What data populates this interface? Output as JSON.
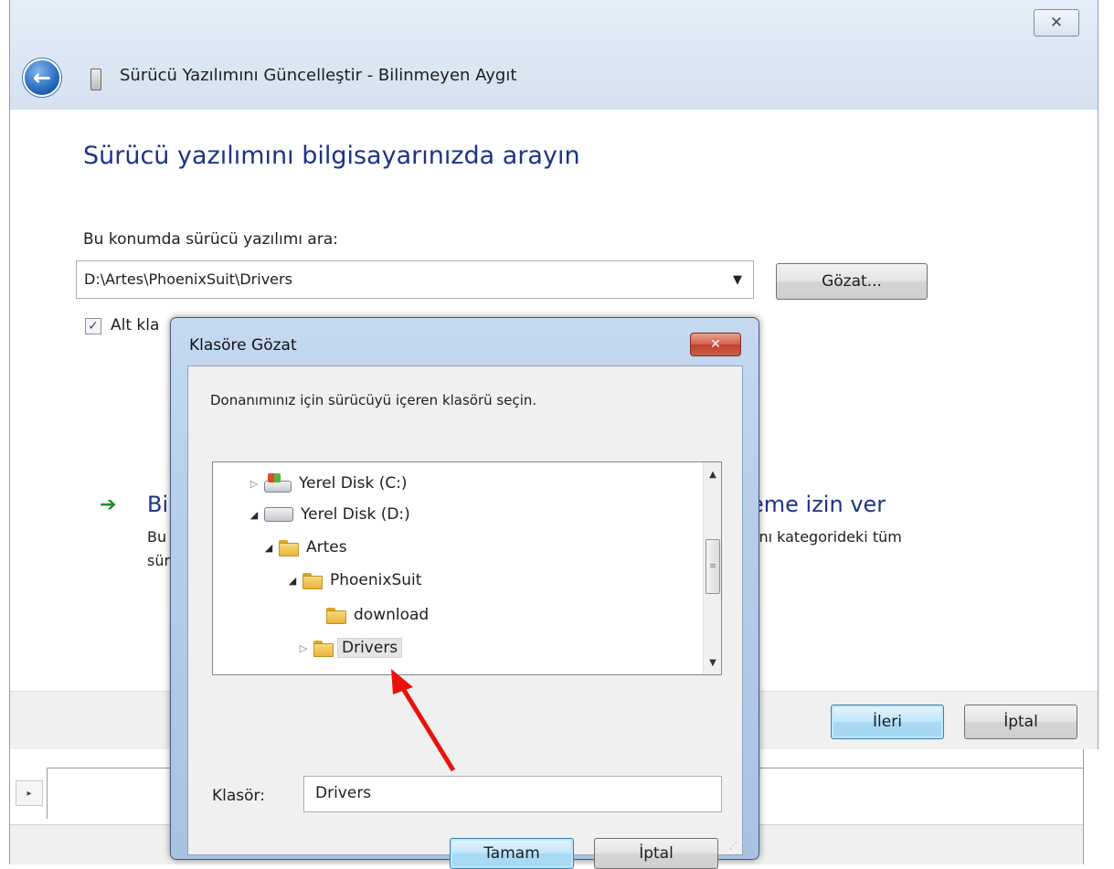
{
  "wizard": {
    "title": "Sürücü Yazılımını Güncelleştir - Bilinmeyen Aygıt",
    "close_glyph": "✕",
    "back_glyph": "←",
    "heading": "Sürücü yazılımını bilgisayarınızda arayın",
    "search_label": "Bu konumda sürücü yazılımı ara:",
    "path_value": "D:\\Artes\\PhoenixSuit\\Drivers",
    "path_dropdown_glyph": "▼",
    "browse_button": "Gözat...",
    "include_subfolders_label_visible": "Alt kla",
    "include_subfolders_checked": true,
    "option_arrow_glyph": "➔",
    "option_title_left": "Bi",
    "option_title_right": "eme izin ver",
    "option_desc_line1_left": "Bu",
    "option_desc_line1_right": "ynı kategorideki tüm",
    "option_desc_line2_left": "sür",
    "next_button": "İleri",
    "cancel_button": "İptal"
  },
  "device_manager": {
    "expand_glyph": "▸"
  },
  "browse_dialog": {
    "title": "Klasöre Gözat",
    "close_glyph": "✕",
    "instruction": "Donanımınız için sürücüyü içeren klasörü seçin.",
    "tree": [
      {
        "label": "Yerel Disk (C:)",
        "expander": "▷",
        "icon": "windows-drive-icon",
        "depth": 0
      },
      {
        "label": "Yerel Disk (D:)",
        "expander": "◢",
        "icon": "drive-icon",
        "depth": 0
      },
      {
        "label": "Artes",
        "expander": "◢",
        "icon": "folder-icon",
        "depth": 1
      },
      {
        "label": "PhoenixSuit",
        "expander": "◢",
        "icon": "folder-icon",
        "depth": 2
      },
      {
        "label": "download",
        "expander": "",
        "icon": "folder-icon",
        "depth": 3
      },
      {
        "label": "Drivers",
        "expander": "▷",
        "icon": "folder-icon",
        "depth": 3,
        "selected": true
      }
    ],
    "scroll_up_glyph": "▲",
    "scroll_down_glyph": "▼",
    "scroll_thumb_glyph": "≡",
    "folder_label": "Klasör:",
    "folder_value": "Drivers",
    "ok_button": "Tamam",
    "cancel_button": "İptal"
  },
  "annotation": {
    "arrow_color": "#e8120c"
  }
}
